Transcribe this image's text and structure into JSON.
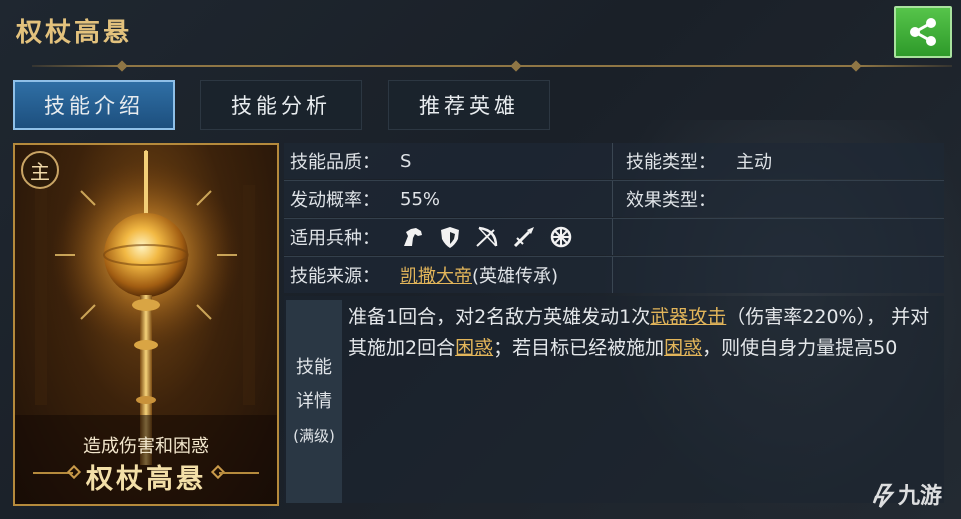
{
  "header": {
    "title": "权杖高悬"
  },
  "tabs": [
    {
      "label": "技能介绍",
      "active": true
    },
    {
      "label": "技能分析",
      "active": false
    },
    {
      "label": "推荐英雄",
      "active": false
    }
  ],
  "card": {
    "badge": "主",
    "subtitle": "造成伤害和困惑",
    "name": "权杖高悬"
  },
  "info": {
    "quality_label": "技能品质：",
    "quality_value": "S",
    "type_label": "技能类型：",
    "type_value": "主动",
    "rate_label": "发动概率：",
    "rate_value": "55%",
    "effect_label": "效果类型：",
    "effect_value": "",
    "troops_label": "适用兵种：",
    "troop_icons": [
      "cavalry-icon",
      "shield-infantry-icon",
      "archer-icon",
      "spear-icon",
      "chariot-wheel-icon"
    ],
    "source_label": "技能来源：",
    "source_link": "凯撒大帝",
    "source_suffix": "(英雄传承)"
  },
  "detail": {
    "label_line1": "技能",
    "label_line2": "详情",
    "label_line3": "(满级)",
    "text_1": "准备1回合，对2名敌方英雄发动1次",
    "link_1": "武器攻击",
    "text_2": "（伤害率220%）， 并对其施加2回合",
    "link_2": "困惑",
    "text_3": "；若目标已经被施加",
    "link_3": "困惑",
    "text_4": "，则使自身力量提高50"
  },
  "watermark": {
    "text": "九游"
  },
  "colors": {
    "gold": "#e3c27d",
    "link": "#e2b55a",
    "active_tab": "#2f6fa5",
    "share_green": "#3fae36"
  }
}
